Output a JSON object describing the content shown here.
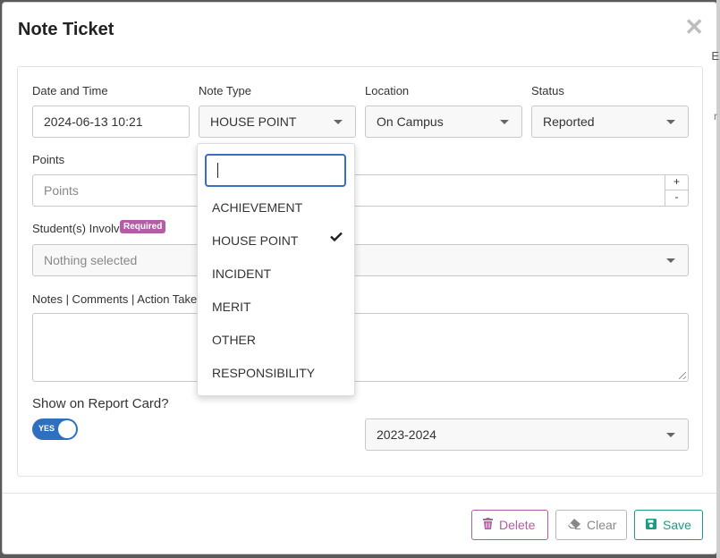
{
  "modal": {
    "title": "Note Ticket",
    "close_glyph": "✕"
  },
  "edge": {
    "text": "E",
    "mark": "r"
  },
  "form": {
    "datetime": {
      "label": "Date and Time",
      "value": "2024-06-13 10:21"
    },
    "note_type": {
      "label": "Note Type",
      "value": "HOUSE POINT"
    },
    "location": {
      "label": "Location",
      "value": "On Campus"
    },
    "status": {
      "label": "Status",
      "value": "Reported"
    },
    "points": {
      "label": "Points",
      "placeholder": "Points",
      "increment": "+",
      "decrement": "-"
    },
    "students": {
      "label": "Student(s) Involved",
      "badge": "Required",
      "value": "Nothing selected"
    },
    "notes": {
      "label": "Notes | Comments | Action Take",
      "value": ""
    },
    "report_card": {
      "label": "Show on Report Card?",
      "toggle_text": "YES",
      "enabled": true
    },
    "school_year": {
      "value": "2023-2024"
    }
  },
  "dropdown": {
    "search_value": "",
    "selected": "HOUSE POINT",
    "options": [
      "ACHIEVEMENT",
      "HOUSE POINT",
      "INCIDENT",
      "MERIT",
      "OTHER",
      "RESPONSIBILITY"
    ]
  },
  "footer": {
    "delete_label": "Delete",
    "clear_label": "Clear",
    "save_label": "Save"
  },
  "colors": {
    "accent": "#3a6fbd",
    "delete": "#b35da5",
    "save": "#1f9a83",
    "toggle": "#2e6fbd"
  }
}
